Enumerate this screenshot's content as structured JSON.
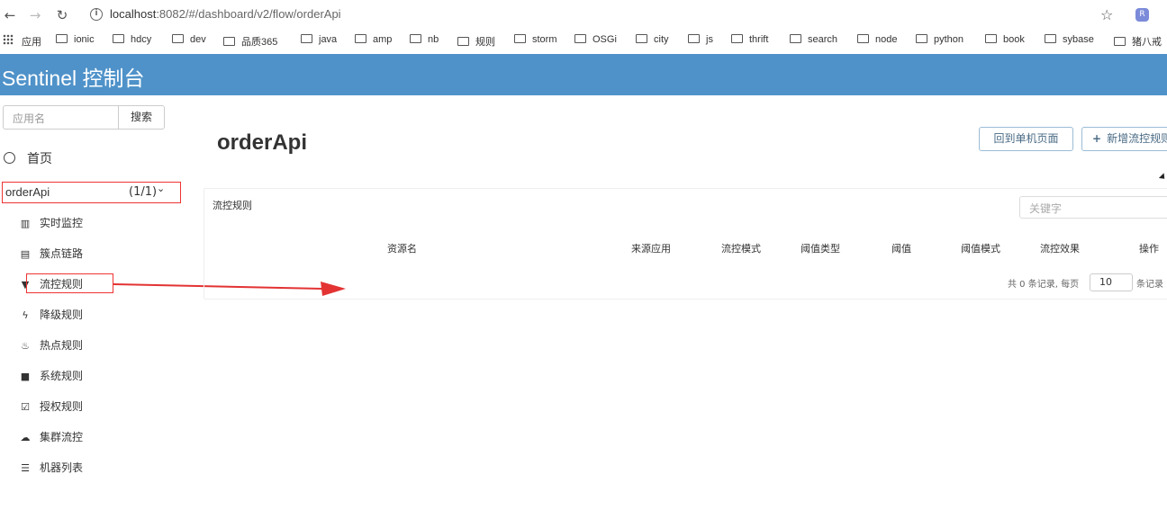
{
  "browser": {
    "url_host": "localhost",
    "url_rest": ":8082/#/dashboard/v2/flow/orderApi",
    "bookmarks": [
      "应用",
      "ionic",
      "hdcy",
      "dev",
      "品质365",
      "java",
      "amp",
      "nb",
      "规则",
      "storm",
      "OSGi",
      "city",
      "js",
      "thrift",
      "search",
      "node",
      "python",
      "book",
      "sybase",
      "猪八戒"
    ]
  },
  "header": {
    "brand": "Sentinel 控制台"
  },
  "sidebar": {
    "search_placeholder": "应用名",
    "search_button": "搜索",
    "home_label": "首页",
    "app_name": "orderApi",
    "app_count": "(1/1)",
    "items": [
      {
        "label": "实时监控",
        "icon": "bar-chart-icon"
      },
      {
        "label": "簇点链路",
        "icon": "list-alt-icon"
      },
      {
        "label": "流控规则",
        "icon": "filter-icon"
      },
      {
        "label": "降级规则",
        "icon": "flash-icon"
      },
      {
        "label": "热点规则",
        "icon": "fire-icon"
      },
      {
        "label": "系统规则",
        "icon": "lock-icon"
      },
      {
        "label": "授权规则",
        "icon": "check-icon"
      },
      {
        "label": "集群流控",
        "icon": "cloud-icon"
      },
      {
        "label": "机器列表",
        "icon": "th-list-icon"
      }
    ]
  },
  "main": {
    "title": "orderApi",
    "back_button": "回到单机页面",
    "add_button": "新增流控规则",
    "panel_title": "流控规则",
    "keyword_placeholder": "关键字",
    "columns": [
      "资源名",
      "来源应用",
      "流控模式",
      "阈值类型",
      "阈值",
      "阈值模式",
      "流控效果",
      "操作"
    ],
    "pager": {
      "prefix": "共 0 条记录, 每页",
      "page_size": "10",
      "suffix": "条记录"
    }
  },
  "colors": {
    "header": "#4f92c9",
    "annotation": "#e33333"
  }
}
